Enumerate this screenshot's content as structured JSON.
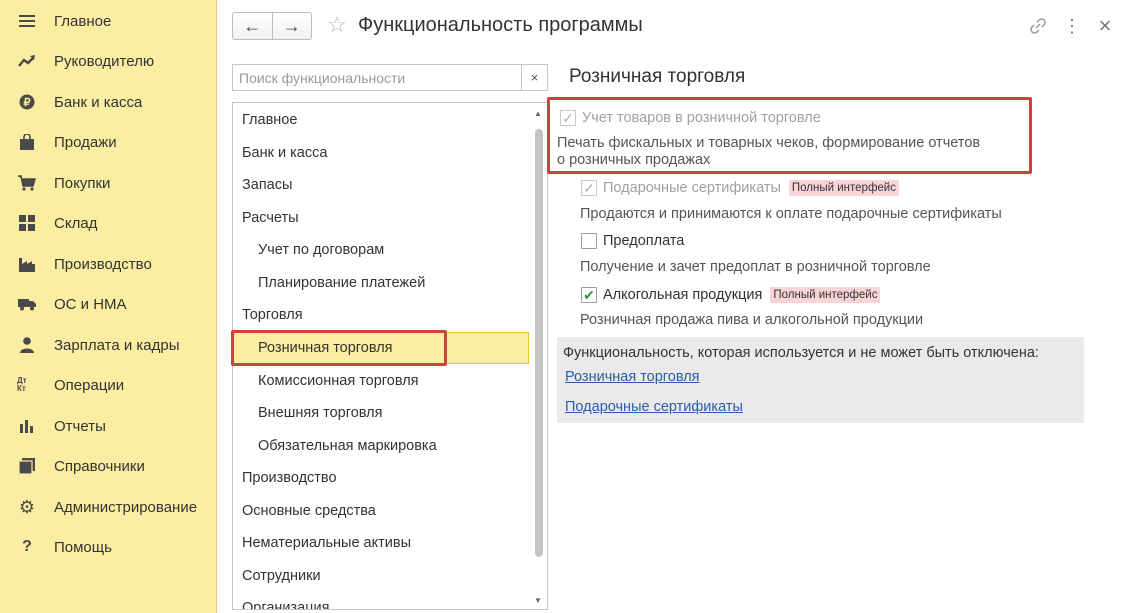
{
  "sidebar": {
    "items": [
      {
        "label": "Главное",
        "icon": "menu-icon"
      },
      {
        "label": "Руководителю",
        "icon": "trend-icon"
      },
      {
        "label": "Банк и касса",
        "icon": "ruble-coin-icon"
      },
      {
        "label": "Продажи",
        "icon": "shopping-bag-icon"
      },
      {
        "label": "Покупки",
        "icon": "cart-icon"
      },
      {
        "label": "Склад",
        "icon": "warehouse-icon"
      },
      {
        "label": "Производство",
        "icon": "factory-icon"
      },
      {
        "label": "ОС и НМА",
        "icon": "truck-icon"
      },
      {
        "label": "Зарплата и кадры",
        "icon": "person-icon"
      },
      {
        "label": "Операции",
        "icon": "dt-kt-icon"
      },
      {
        "label": "Отчеты",
        "icon": "bar-chart-icon"
      },
      {
        "label": "Справочники",
        "icon": "books-icon"
      },
      {
        "label": "Администрирование",
        "icon": "gear-icon"
      },
      {
        "label": "Помощь",
        "icon": "question-icon"
      }
    ],
    "dt_kt_text": "Дт Кт"
  },
  "header": {
    "title": "Функциональность программы",
    "back": "←",
    "forward": "→",
    "star": "☆",
    "link": "🔗",
    "more": "⋮",
    "close": "×"
  },
  "search": {
    "placeholder": "Поиск функциональности",
    "value": "",
    "clear": "×"
  },
  "tree": {
    "items": [
      {
        "label": "Главное",
        "level": 0
      },
      {
        "label": "Банк и касса",
        "level": 0
      },
      {
        "label": "Запасы",
        "level": 0
      },
      {
        "label": "Расчеты",
        "level": 0
      },
      {
        "label": "Учет по договорам",
        "level": 1
      },
      {
        "label": "Планирование платежей",
        "level": 1
      },
      {
        "label": "Торговля",
        "level": 0
      },
      {
        "label": "Розничная торговля",
        "level": 1,
        "selected": true
      },
      {
        "label": "Комиссионная торговля",
        "level": 1
      },
      {
        "label": "Внешняя торговля",
        "level": 1
      },
      {
        "label": "Обязательная маркировка",
        "level": 1
      },
      {
        "label": "Производство",
        "level": 0
      },
      {
        "label": "Основные средства",
        "level": 0
      },
      {
        "label": "Нематериальные активы",
        "level": 0
      },
      {
        "label": "Сотрудники",
        "level": 0
      },
      {
        "label": "Организация",
        "level": 0
      }
    ],
    "scroll_up": "▲",
    "scroll_down": "▼"
  },
  "main": {
    "section_title": "Розничная торговля",
    "options": [
      {
        "label": "Учет товаров в розничной торговле",
        "checked": true,
        "disabled": true,
        "mark": "✓",
        "description": [
          "Печать фискальных и товарных чеков, формирование отчетов",
          "о розничных продажах"
        ]
      },
      {
        "label": "Подарочные сертификаты",
        "checked": true,
        "disabled": true,
        "mark": "✓",
        "badge": "Полный интерфейс",
        "description": [
          "Продаются и принимаются к оплате подарочные сертификаты"
        ]
      },
      {
        "label": "Предоплата",
        "checked": false,
        "disabled": false,
        "mark": "",
        "description": [
          "Получение и зачет предоплат в розничной торговле"
        ]
      },
      {
        "label": "Алкогольная продукция",
        "checked": true,
        "disabled": false,
        "mark": "✔",
        "badge": "Полный интерфейс",
        "description": [
          "Розничная продажа пива и алкогольной продукции"
        ]
      }
    ],
    "info": {
      "text": "Функциональность, которая используется и не может быть отключена:",
      "links": [
        "Розничная торговля",
        "Подарочные сертификаты"
      ]
    }
  },
  "colors": {
    "sidebar_bg": "#fbeda2",
    "highlight_frame": "#c9463d",
    "link": "#2a5dac",
    "badge_bg": "#f8d4d6",
    "check_green": "#2c9b3a"
  }
}
